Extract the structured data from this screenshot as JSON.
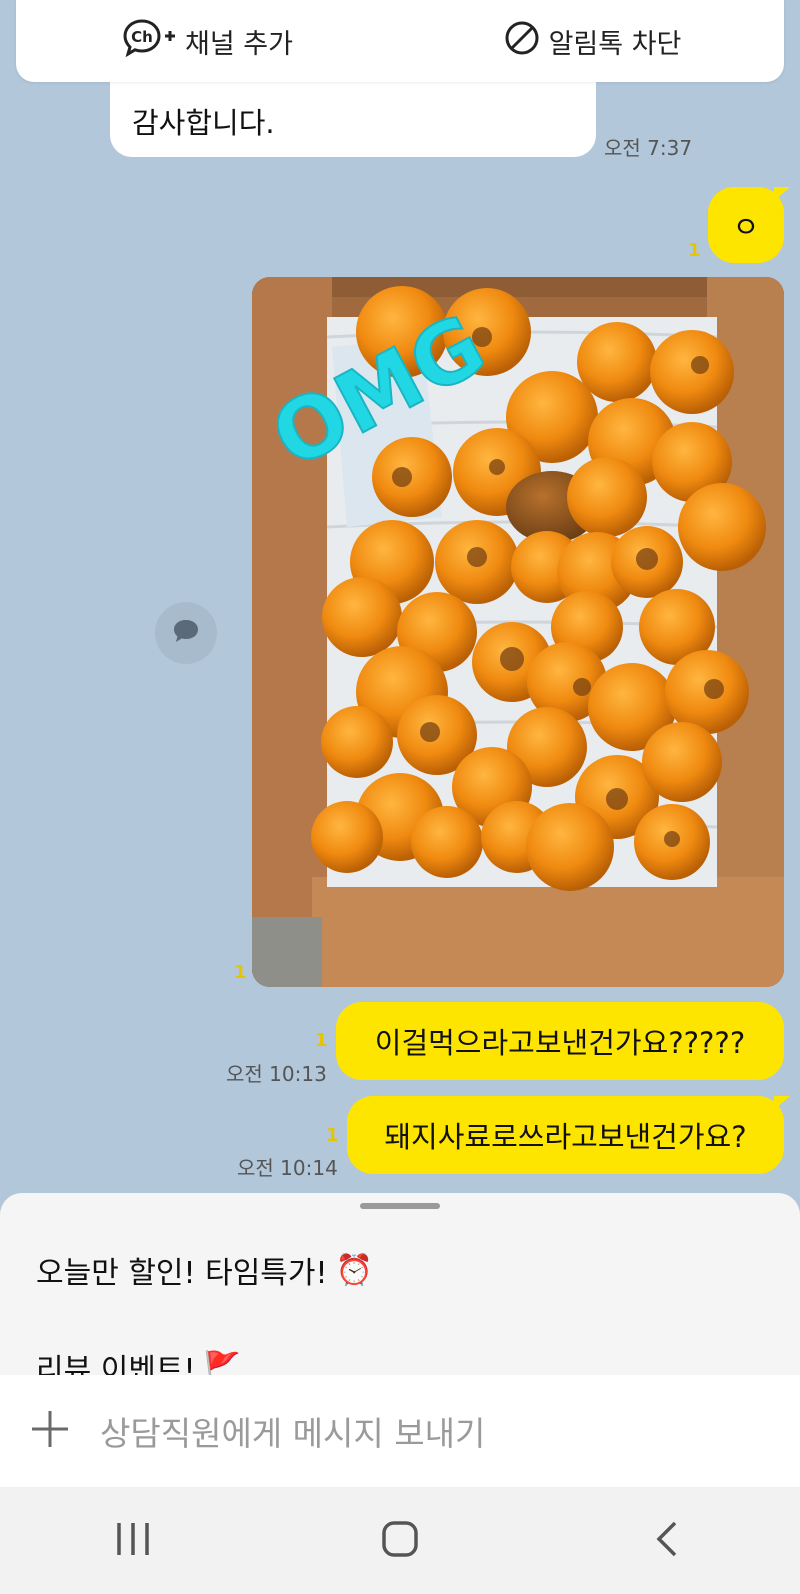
{
  "topbar": {
    "channel_icon_text": "Ch",
    "add_channel_label": "채널 추가",
    "block_label": "알림톡 차단"
  },
  "messages": {
    "incoming": {
      "text": "감사합니다.",
      "time": "오전 7:37"
    },
    "out1": {
      "text": "ㅇ",
      "unread": "1"
    },
    "photo": {
      "sticker": "OMG",
      "unread": "1"
    },
    "out2": {
      "text": "이걸먹으라고보낸건가요?????",
      "unread": "1",
      "time": "오전 10:13"
    },
    "out3": {
      "text": "돼지사료로쓰라고보낸건가요?",
      "unread": "1",
      "time": "오전 10:14"
    }
  },
  "sheet": {
    "items": [
      {
        "label": "오늘만 할인! 타임특가!",
        "emoji": "⏰"
      },
      {
        "label": "리뷰 이벤트!",
        "emoji": "🚩"
      }
    ]
  },
  "input": {
    "placeholder": "상담직원에게 메시지 보내기"
  },
  "colors": {
    "background": "#b2c7da",
    "my_bubble": "#fee500",
    "unread": "#e8c400"
  }
}
